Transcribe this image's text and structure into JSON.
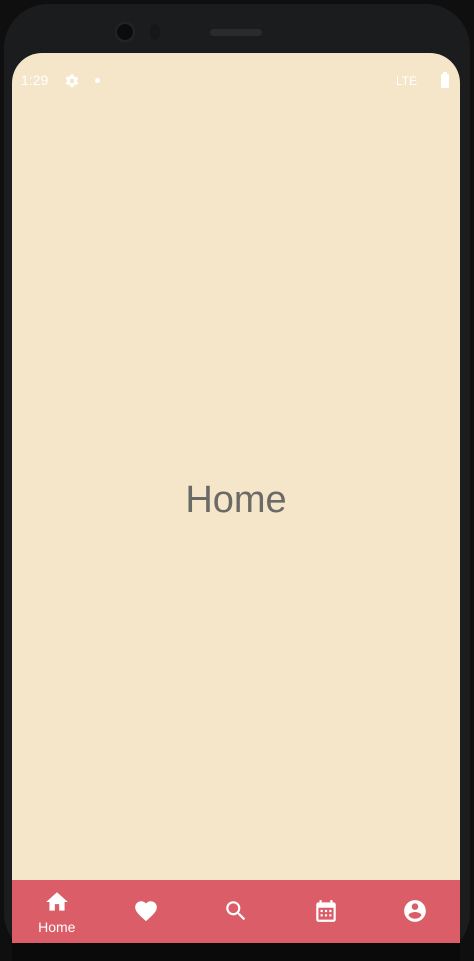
{
  "status_bar": {
    "time": "1:29",
    "network": "LTE",
    "icons": [
      "gear-icon",
      "dot-icon",
      "battery-icon"
    ]
  },
  "main": {
    "title": "Home"
  },
  "bottom_nav": {
    "active_index": 0,
    "items": [
      {
        "icon": "home-icon",
        "label": "Home"
      },
      {
        "icon": "heart-icon",
        "label": ""
      },
      {
        "icon": "search-icon",
        "label": ""
      },
      {
        "icon": "calendar-icon",
        "label": ""
      },
      {
        "icon": "account-icon",
        "label": ""
      }
    ]
  },
  "colors": {
    "background": "#f5e5c9",
    "nav_bar": "#da5d67",
    "title_text": "#6b6a66",
    "nav_icon": "#ffffff"
  }
}
